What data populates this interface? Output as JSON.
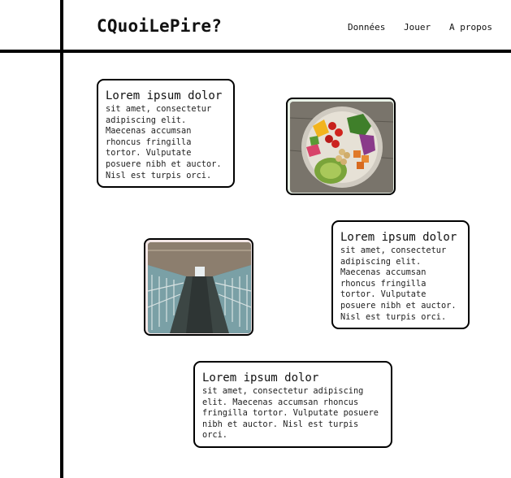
{
  "header": {
    "logo": "CQuoiLePire?",
    "nav": [
      "Données",
      "Jouer",
      "A propos"
    ]
  },
  "cards": [
    {
      "title": "Lorem ipsum dolor",
      "body": "sit amet, consectetur\nadipiscing elit.\nMaecenas accumsan\nrhoncus fringilla\ntortor. Vulputate\nposuere nibh et auctor.\nNisl est turpis orci."
    },
    {
      "title": "Lorem ipsum dolor",
      "body": "sit amet, consectetur\nadipiscing elit.\nMaecenas accumsan\nrhoncus fringilla\ntortor. Vulputate\nposuere nibh et auctor.\nNisl est turpis orci."
    },
    {
      "title": "Lorem ipsum dolor",
      "body": "sit amet, consectetur adipiscing elit. Maecenas accumsan rhoncus fringilla tortor. Vulputate posuere nibh et auctor. Nisl est turpis orci."
    }
  ],
  "images": [
    {
      "subject": "salad-bowl",
      "frame_color": "#e8f1e6"
    },
    {
      "subject": "factory-farm-barn",
      "frame_color": "#f3e6e6"
    }
  ]
}
